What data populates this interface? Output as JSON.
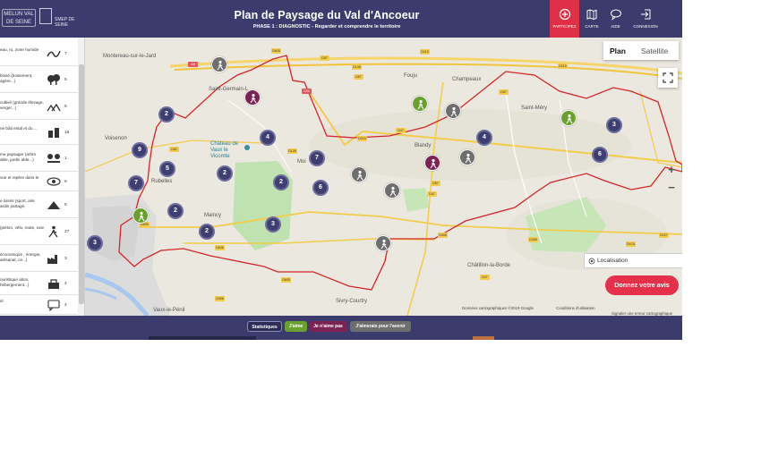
{
  "header": {
    "logo1_text": "MELUN VAL DE SEINE",
    "logo2_text": "SMEP DE SEINE",
    "title": "Plan de Paysage du Val d'Ancoeur",
    "subtitle": "PHASE 1 : DIAGNOSTIC - Regarder et comprendre le territoire",
    "nav": [
      {
        "label": "PARTICIPEZ",
        "icon": "plus-circle-icon",
        "active": true
      },
      {
        "label": "CARTE",
        "icon": "map-icon"
      },
      {
        "label": "AIDE",
        "icon": "chat-bubble-icon"
      },
      {
        "label": "CONNEXION",
        "icon": "login-icon"
      }
    ]
  },
  "sidebar": {
    "items": [
      {
        "label": "eau, ru, zone humide",
        "count": "7",
        "icon": "water-icon"
      },
      {
        "label": "boisé (boisement, agère...)",
        "count": "5",
        "icon": "tree-icon"
      },
      {
        "label": "cultivé (grande élevage, verger...)",
        "count": "5",
        "icon": "field-icon"
      },
      {
        "label": "ne bâti ental et du ...",
        "count": "16",
        "icon": "building-icon"
      },
      {
        "label": "me paysager (arbre able, jardin able...)",
        "count": "1",
        "icon": "garden-icon"
      },
      {
        "label": "vue et repère dans le",
        "count": "6",
        "icon": "eye-icon"
      },
      {
        "label": "e loisirs (sport, aire ardin partagé,",
        "count": "5",
        "icon": "leisure-icon"
      },
      {
        "label": "(piéton, vélo, route, voie",
        "count": "27",
        "icon": "walk-icon"
      },
      {
        "label": "économique , énergie, artisanat, ce...)",
        "count": "3",
        "icon": "factory-icon"
      },
      {
        "label": "ouristique ation, hébergement...)",
        "count": "4",
        "icon": "tourism-icon"
      },
      {
        "label": "el",
        "count": "4",
        "icon": "comment-icon"
      }
    ]
  },
  "map": {
    "maptype_plan": "Plan",
    "maptype_satellite": "Satellite",
    "localisation_label": "Localisation",
    "cta_label": "Donnez votre avis",
    "attribution": [
      "Données cartographiques ©2019 Google",
      "Conditions d'utilisation",
      "Signaler une erreur cartographique"
    ],
    "places": [
      {
        "name": "Montereau-sur-le-Jard",
        "pos": "nw"
      },
      {
        "name": "Saint-Germain-L",
        "pos": "n"
      },
      {
        "name": "Fouju",
        "pos": "n2"
      },
      {
        "name": "Champeaux",
        "pos": "ne"
      },
      {
        "name": "Saint-Méry",
        "pos": "e"
      },
      {
        "name": "Voisenon",
        "pos": "w"
      },
      {
        "name": "Château de Vaux le Vicomte",
        "pos": "c"
      },
      {
        "name": "Moi",
        "pos": "c2"
      },
      {
        "name": "Blandy",
        "pos": "c3"
      },
      {
        "name": "Rubelles",
        "pos": "w2"
      },
      {
        "name": "Maincy",
        "pos": "sw"
      },
      {
        "name": "Châtillon-la-Borde",
        "pos": "se"
      },
      {
        "name": "Sivry-Courtry",
        "pos": "s"
      },
      {
        "name": "Vaux-le-Pénil",
        "pos": "s2"
      }
    ],
    "roads": [
      "D605",
      "A5",
      "D57",
      "D138",
      "D57",
      "D215",
      "D215",
      "D50",
      "D57",
      "D47",
      "D215",
      "D82",
      "D126",
      "D57",
      "D47",
      "D408",
      "D408",
      "D605",
      "D636",
      "D408",
      "D47A",
      "D227",
      "D605",
      "D47"
    ],
    "clusters": [
      "2",
      "4",
      "9",
      "5",
      "7",
      "2",
      "2",
      "2",
      "3",
      "2",
      "7",
      "6",
      "4",
      "3",
      "6",
      "3"
    ]
  },
  "filters": {
    "stats": "Statistiques",
    "jaime": "J'aime",
    "jaime_pas": "Je n'aime pas",
    "avenir": "J'aimerais pour l'avenir"
  },
  "colors": {
    "header_bg": "#3b3b6e",
    "accent_red": "#e03048",
    "cluster": "#3e3e70",
    "like_green": "#6aa12e",
    "dislike_plum": "#7c2255",
    "future_gray": "#6e6e6e",
    "boundary": "#d4252b"
  }
}
